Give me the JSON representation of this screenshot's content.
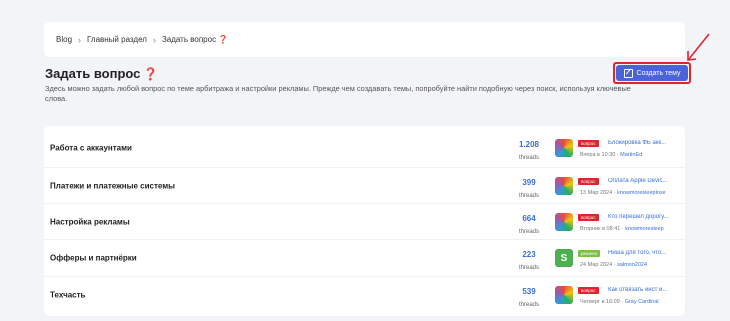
{
  "breadcrumb": {
    "items": [
      "Blog",
      "Главный раздел",
      "Задать вопрос"
    ],
    "sep": "›",
    "question_mark": "❓"
  },
  "page": {
    "title": "Задать вопрос",
    "title_icon": "❓",
    "description": "Здесь можно задать любой вопрос по теме арбитража и настройки рекламы. Прежде чем создавать темы, попробуйте найти подобную через поиск, используя ключевые слова."
  },
  "create_button": {
    "label": "Создать тему",
    "icon": "edit-icon"
  },
  "forums": [
    {
      "name": "Работа с аккаунтами",
      "count": "1.208",
      "count_label": "threads",
      "badge": "вопрос",
      "badge_color": "#e0242e",
      "last_title": "Блокировка ФБ акк...",
      "last_date": "Вчера в 10:30",
      "last_user": "MartinEd",
      "avatar": "colorful"
    },
    {
      "name": "Платежи и платежные системы",
      "count": "399",
      "count_label": "threads",
      "badge": "вопрос",
      "badge_color": "#e0242e",
      "last_title": "Оплата Apple Devic...",
      "last_date": "13 Мар 2024",
      "last_user": "knowmoresleeplose",
      "avatar": "colorful"
    },
    {
      "name": "Настройка рекламы",
      "count": "664",
      "count_label": "threads",
      "badge": "вопрос",
      "badge_color": "#e0242e",
      "last_title": "Кто перешел дорогу...",
      "last_date": "Вторник в 08:41",
      "last_user": "knowmoresleep",
      "avatar": "colorful"
    },
    {
      "name": "Офферы и партнёрки",
      "count": "223",
      "count_label": "threads",
      "badge": "решено",
      "badge_color": "#7cc242",
      "last_title": "Ниша для того, что...",
      "last_date": "24 Мар 2024",
      "last_user": "salmon2024",
      "avatar": "S"
    },
    {
      "name": "Техчасть",
      "count": "539",
      "count_label": "threads",
      "badge": "вопрос",
      "badge_color": "#e0242e",
      "last_title": "Как отвязать инст и...",
      "last_date": "Четверг в 16:09",
      "last_user": "Gray Cardinal",
      "avatar": "colorful"
    }
  ]
}
